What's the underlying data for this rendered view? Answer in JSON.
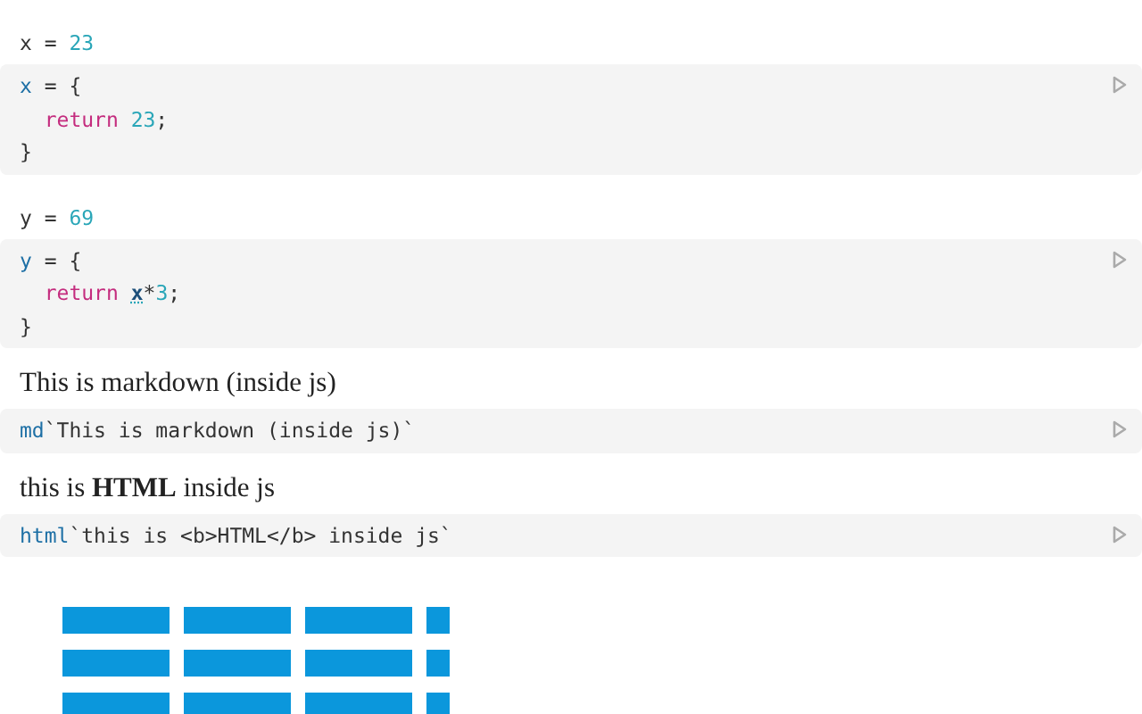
{
  "cells": [
    {
      "kind": "value",
      "output": [
        {
          "text": "x =",
          "kind": "plain"
        },
        {
          "text": "23",
          "kind": "number"
        }
      ],
      "code": [
        {
          "indent": false,
          "tokens": [
            {
              "text": "x",
              "kind": "def"
            },
            {
              "text": "= {",
              "kind": "plain"
            }
          ]
        },
        {
          "indent": true,
          "tokens": [
            {
              "text": "return",
              "kind": "keyword"
            },
            {
              "text": "23",
              "kind": "number"
            },
            {
              "text": ";",
              "kind": "tail"
            }
          ]
        },
        {
          "indent": false,
          "tokens": [
            {
              "text": "}",
              "kind": "plain"
            }
          ]
        }
      ]
    },
    {
      "kind": "value",
      "output": [
        {
          "text": "y =",
          "kind": "plain"
        },
        {
          "text": "69",
          "kind": "number"
        }
      ],
      "code": [
        {
          "indent": false,
          "tokens": [
            {
              "text": "y",
              "kind": "def"
            },
            {
              "text": "= {",
              "kind": "plain"
            }
          ]
        },
        {
          "indent": true,
          "tokens": [
            {
              "text": "return",
              "kind": "keyword"
            },
            {
              "text": "x",
              "kind": "ref"
            },
            {
              "text": "*",
              "kind": "tail"
            },
            {
              "text": "3",
              "kind": "number-tail"
            },
            {
              "text": ";",
              "kind": "tail"
            }
          ]
        },
        {
          "indent": false,
          "tokens": [
            {
              "text": "}",
              "kind": "plain"
            }
          ]
        }
      ]
    },
    {
      "kind": "prose",
      "text": "This is markdown (inside js)",
      "code": [
        {
          "indent": false,
          "tokens": [
            {
              "text": "md",
              "kind": "def"
            },
            {
              "text": "`This is markdown (inside js)`",
              "kind": "tail"
            }
          ]
        }
      ]
    },
    {
      "kind": "prose",
      "text": "this is **HTML** inside js",
      "code": [
        {
          "indent": false,
          "tokens": [
            {
              "text": "html",
              "kind": "def"
            },
            {
              "text": "`this is <b>HTML</b> inside js`",
              "kind": "tail"
            }
          ]
        }
      ]
    }
  ]
}
